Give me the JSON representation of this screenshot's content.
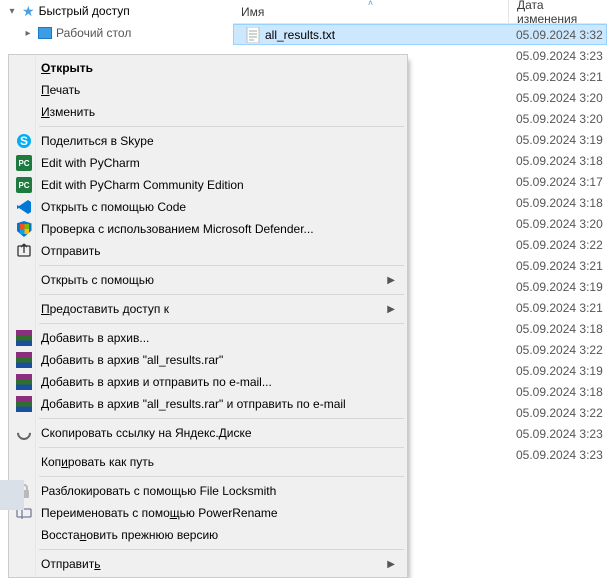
{
  "sidebar": {
    "quick_access": "Быстрый доступ",
    "desktop": "Рабочий стол"
  },
  "headers": {
    "name": "Имя",
    "date": "Дата изменения"
  },
  "files": [
    {
      "name": "all_results.txt",
      "date": "05.09.2024 3:32",
      "selected": true,
      "icon": "txt"
    },
    {
      "name": "",
      "date": "05.09.2024 3:23"
    },
    {
      "name": "",
      "date": "05.09.2024 3:21"
    },
    {
      "name": "",
      "date": "05.09.2024 3:20"
    },
    {
      "name": "",
      "date": "05.09.2024 3:20"
    },
    {
      "name": "",
      "date": "05.09.2024 3:19"
    },
    {
      "name": "",
      "date": "05.09.2024 3:18"
    },
    {
      "name": "",
      "date": "05.09.2024 3:17"
    },
    {
      "name": "",
      "date": "05.09.2024 3:18"
    },
    {
      "name": "",
      "date": "05.09.2024 3:20"
    },
    {
      "name": "",
      "date": "05.09.2024 3:22"
    },
    {
      "name": "",
      "date": "05.09.2024 3:21"
    },
    {
      "name": "",
      "date": "05.09.2024 3:19"
    },
    {
      "name": "",
      "date": "05.09.2024 3:21"
    },
    {
      "name": "",
      "date": "05.09.2024 3:18"
    },
    {
      "name": "",
      "date": "05.09.2024 3:22"
    },
    {
      "name": "",
      "date": "05.09.2024 3:19"
    },
    {
      "name": "",
      "date": "05.09.2024 3:18"
    },
    {
      "name": "",
      "date": "05.09.2024 3:22"
    },
    {
      "name": "",
      "date": "05.09.2024 3:23"
    },
    {
      "name": "",
      "date": "05.09.2024 3:23"
    }
  ],
  "menu": [
    {
      "kind": "item",
      "label": "Открыть",
      "hot": 0,
      "bold": true,
      "icon": ""
    },
    {
      "kind": "item",
      "label": "Печать",
      "hot": 0,
      "icon": ""
    },
    {
      "kind": "item",
      "label": "Изменить",
      "hot": 0,
      "icon": ""
    },
    {
      "kind": "sep"
    },
    {
      "kind": "item",
      "label": "Поделиться в Skype",
      "icon": "skype"
    },
    {
      "kind": "item",
      "label": "Edit with PyCharm",
      "icon": "pycharm"
    },
    {
      "kind": "item",
      "label": "Edit with PyCharm Community Edition",
      "icon": "pycharm"
    },
    {
      "kind": "item",
      "label": "Открыть с помощью Code",
      "icon": "vscode"
    },
    {
      "kind": "item",
      "label": "Проверка с использованием Microsoft Defender...",
      "icon": "defender"
    },
    {
      "kind": "item",
      "label": "Отправить",
      "icon": "share"
    },
    {
      "kind": "sep"
    },
    {
      "kind": "item",
      "label": "Открыть с помощью",
      "hot": 17,
      "submenu": true
    },
    {
      "kind": "sep"
    },
    {
      "kind": "item",
      "label": "Предоставить доступ к",
      "hot": 0,
      "submenu": true
    },
    {
      "kind": "sep"
    },
    {
      "kind": "item",
      "label": "Добавить в архив...",
      "icon": "rar"
    },
    {
      "kind": "item",
      "label": "Добавить в архив \"all_results.rar\"",
      "icon": "rar"
    },
    {
      "kind": "item",
      "label": "Добавить в архив и отправить по e-mail...",
      "icon": "rar"
    },
    {
      "kind": "item",
      "label": "Добавить в архив \"all_results.rar\" и отправить по e-mail",
      "icon": "rar"
    },
    {
      "kind": "sep"
    },
    {
      "kind": "item",
      "label": "Скопировать ссылку на Яндекс.Диске",
      "icon": "link"
    },
    {
      "kind": "sep"
    },
    {
      "kind": "item",
      "label": "Копировать как путь",
      "hot": 3
    },
    {
      "kind": "sep"
    },
    {
      "kind": "item",
      "label": "Разблокировать с помощью File Locksmith",
      "icon": "lock"
    },
    {
      "kind": "item",
      "label": "Переименовать с помощью PowerRename",
      "hot": 20,
      "icon": "rename"
    },
    {
      "kind": "item",
      "label": "Восстановить прежнюю версию",
      "hot": 6
    },
    {
      "kind": "sep"
    },
    {
      "kind": "item",
      "label": "Отправить",
      "hot": 8,
      "submenu": true
    }
  ]
}
